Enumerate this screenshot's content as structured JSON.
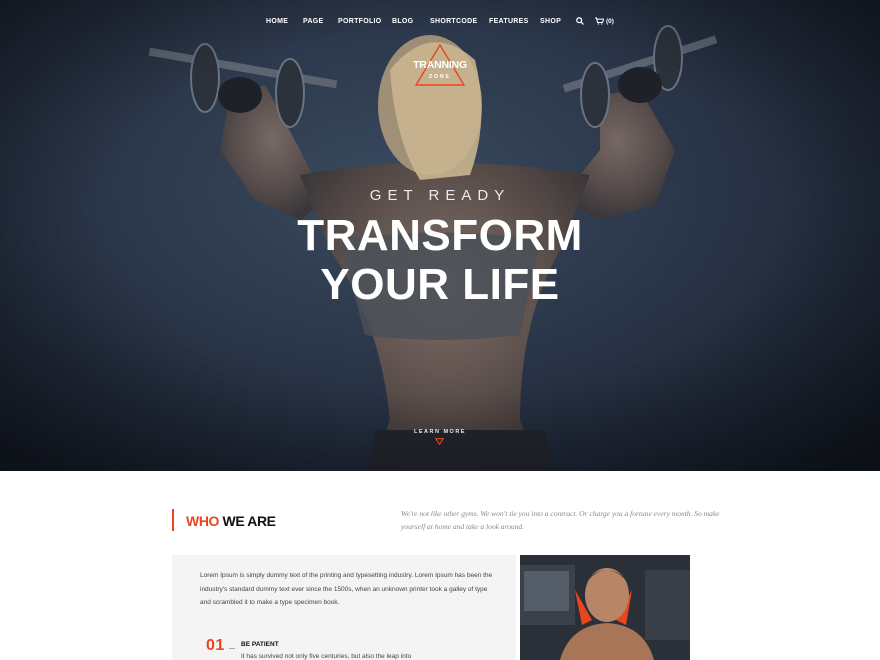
{
  "nav": {
    "items": [
      "HOME",
      "PAGE",
      "PORTFOLIO",
      "BLOG",
      "SHORTCODE",
      "FEATURES",
      "SHOP"
    ],
    "search_icon": "search-icon",
    "cart_icon": "cart-icon",
    "cart_count": "(0)"
  },
  "logo": {
    "title": "TRANNING",
    "subtitle": "ZONE"
  },
  "hero": {
    "eyebrow": "GET READY",
    "headline_line1": "TRANSFORM",
    "headline_line2": "YOUR LIFE",
    "cta": "LEARN MORE",
    "accent": "#e8461e"
  },
  "about": {
    "title_accent": "WHO",
    "title_rest": "WE ARE",
    "intro": "We're not like other gyms. We won't tie you into a contract. Or charge you a fortune every month. So make yourself at home and take a look around.",
    "body": "Lorem Ipsum is simply dummy text of the printing and typesetting industry. Lorem Ipsum has been the industry's standard dummy text ever since the 1500s, when an unknown printer took a galley of type and scrambled it to make a type specimen book.",
    "steps": [
      {
        "number": "01",
        "title": "BE PATIENT",
        "text": "It has survived not only five centuries, but also the leap into"
      }
    ]
  }
}
